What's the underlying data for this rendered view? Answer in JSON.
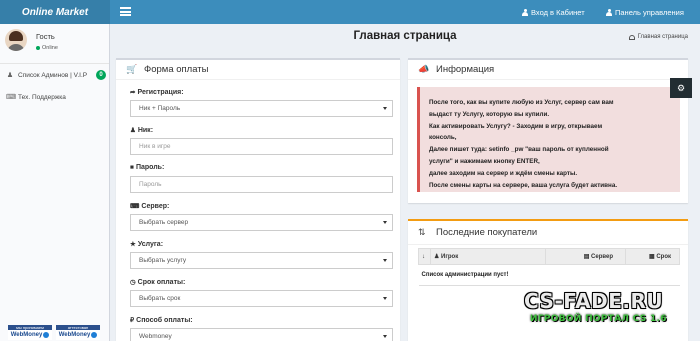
{
  "app": {
    "logo": "Online Market"
  },
  "topnav": {
    "login_label": "Вход в Кабинет",
    "panel_label": "Панель управления"
  },
  "user": {
    "name": "Гость",
    "status": "Online"
  },
  "sidebar": {
    "items": [
      {
        "label": "Список Админов | V.I.P",
        "icon": "user-icon",
        "badge": "0"
      },
      {
        "label": "Тех. Поддержка",
        "icon": "support-icon"
      }
    ],
    "webmoney": [
      {
        "top": "мы принимаем",
        "brand": "WebMoney"
      },
      {
        "top": "аттестован",
        "brand": "WebMoney"
      }
    ]
  },
  "page": {
    "title": "Главная страница",
    "breadcrumb": "Главная страница"
  },
  "payment_form": {
    "title": "Форма оплаты",
    "fields": {
      "registration": {
        "label": "Регистрация:",
        "value": "Ник + Пароль"
      },
      "nick": {
        "label": "Ник:",
        "placeholder": "Ник в игре"
      },
      "password": {
        "label": "Пароль:",
        "placeholder": "Пароль"
      },
      "server": {
        "label": "Сервер:",
        "value": "Выбрать сервер"
      },
      "service": {
        "label": "Услуга:",
        "value": "Выбрать услугу"
      },
      "term": {
        "label": "Срок оплаты:",
        "value": "Выбрать срок"
      },
      "method": {
        "label": "Способ оплаты:",
        "value": "Webmoney"
      }
    }
  },
  "info": {
    "title": "Информация",
    "lines": [
      "После того, как вы купите любую из Услуг, сервер сам вам",
      "выдаст ту Услугу, которую вы купили.",
      "Как активировать Услугу? - Заходим в игру, открываем",
      "консоль,",
      "Далее пишет туда: setinfo _pw \"ваш пароль от купленной",
      "услуги\" и нажимаем кнопку ENTER,",
      "далее заходим на сервер и ждём смены карты.",
      "После смены карты на сервере, ваша услуга будет активна."
    ]
  },
  "buyers": {
    "title": "Последние покупатели",
    "columns": [
      "Игрок",
      "Сервер",
      "Срок"
    ],
    "empty_text": "Список администрации пуст!"
  },
  "watermark": {
    "main": "CS-FADE.RU",
    "sub": "ИГРОВОЙ ПОРТАЛ CS 1.6"
  },
  "colors": {
    "topbar": "#3c8dbc",
    "logo_bg": "#367fa9",
    "online": "#00a65a",
    "alert_bg": "#f2dede",
    "alert_border": "#d9534f"
  }
}
